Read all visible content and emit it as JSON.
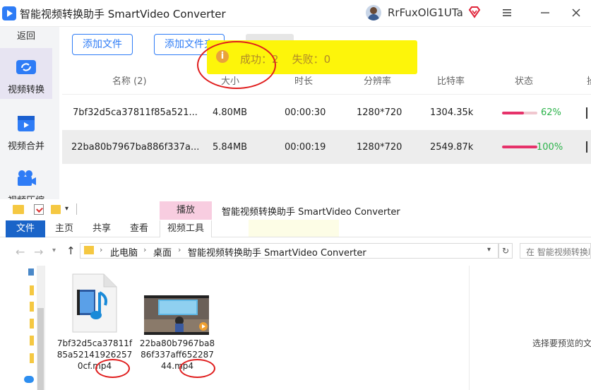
{
  "app": {
    "title": "智能视频转换助手 SmartVideo Converter",
    "user_name": "RrFuxOlG1UTa",
    "accent_color": "#2e7cf6"
  },
  "sidebar": {
    "back_label": "返回",
    "items": [
      {
        "label": "视频转换",
        "icon": "video-convert-icon",
        "active": true
      },
      {
        "label": "视频合并",
        "icon": "video-merge-icon",
        "active": false
      },
      {
        "label": "视频压缩",
        "icon": "video-compress-icon",
        "active": false
      }
    ]
  },
  "toolbar": {
    "add_file_label": "添加文件",
    "add_folder_label": "添加文件夹"
  },
  "table": {
    "headers": [
      "名称 (2)",
      "大小",
      "时长",
      "分辨率",
      "比特率",
      "状态",
      "操作"
    ],
    "rows": [
      {
        "name": "7bf32d5ca37811f85a521...",
        "size": "4.80MB",
        "duration": "00:00:30",
        "resolution": "1280*720",
        "bitrate": "1304.35k",
        "progress": 0.62,
        "progress_label": "62%"
      },
      {
        "name": "22ba80b7967ba886f337a...",
        "size": "5.84MB",
        "duration": "00:00:19",
        "resolution": "1280*720",
        "bitrate": "2549.87k",
        "progress": 1.0,
        "progress_label": "100%"
      }
    ]
  },
  "toast": {
    "text": "成功：2    失败：0",
    "background": "#fdf50a"
  },
  "explorer": {
    "title": "智能视频转换助手 SmartVideo Converter",
    "play_tab_label": "播放",
    "ribbon_tabs": [
      "文件",
      "主页",
      "共享",
      "查看",
      "视频工具"
    ],
    "breadcrumbs": [
      "此电脑",
      "桌面",
      "智能视频转换助手 SmartVideo Converter"
    ],
    "search_placeholder": "在 智能视频转换助手 SmartVideo Converter 中搜索",
    "preview_text": "选择要预览的文件。",
    "files": [
      {
        "name": "7bf32d5ca37811f85a521419262570cf.mp4",
        "icon": "media-file-icon"
      },
      {
        "name": "22ba80b7967ba886f337aff65228744.mp4",
        "icon": "video-thumbnail"
      }
    ]
  }
}
